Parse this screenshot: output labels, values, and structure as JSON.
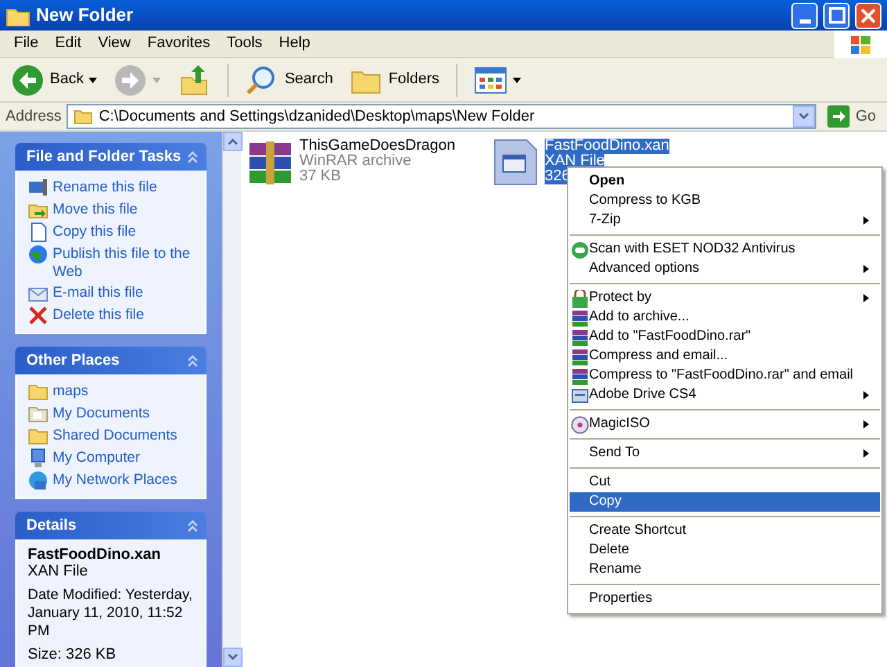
{
  "window": {
    "title": "New Folder"
  },
  "menu_bar": [
    "File",
    "Edit",
    "View",
    "Favorites",
    "Tools",
    "Help"
  ],
  "toolbar": [
    {
      "kind": "back",
      "label": "Back"
    },
    {
      "kind": "forward"
    },
    {
      "kind": "up"
    },
    {
      "kind": "search",
      "label": "Search"
    },
    {
      "kind": "folders",
      "label": "Folders"
    },
    {
      "kind": "views"
    }
  ],
  "address_bar": {
    "label": "Address",
    "value": "C:\\Documents and Settings\\dzanided\\Desktop\\maps\\New Folder",
    "go": "Go"
  },
  "side_panels": [
    {
      "kind": "links",
      "title": "File and Folder Tasks",
      "items": [
        "Rename this file",
        "Move this file",
        "Copy this file",
        "Publish this file to the Web",
        "E-mail this file",
        "Delete this file"
      ]
    },
    {
      "kind": "links",
      "title": "Other Places",
      "items": [
        "maps",
        "My Documents",
        "Shared Documents",
        "My Computer",
        "My Network Places"
      ]
    },
    {
      "kind": "details",
      "title": "Details",
      "name": "FastFoodDino.xan",
      "type": "XAN File",
      "modified": "Date Modified: Yesterday, January 11, 2010, 11:52 PM",
      "size": "Size: 326 KB"
    }
  ],
  "files": [
    {
      "kind": "rar",
      "name": "ThisGameDoesDragon",
      "type": "WinRAR archive",
      "size": "37 KB",
      "selected": false
    },
    {
      "kind": "document",
      "name": "FastFoodDino.xan",
      "type": "XAN File",
      "size": "326",
      "selected": true
    }
  ],
  "context_menu": [
    {
      "kind": "item",
      "label": "Open",
      "default": true,
      "submenu": false,
      "selected": false
    },
    {
      "kind": "item",
      "label": "Compress to KGB",
      "default": false,
      "submenu": false,
      "selected": false
    },
    {
      "kind": "item",
      "label": "7-Zip",
      "default": false,
      "submenu": true,
      "selected": false
    },
    {
      "kind": "separator"
    },
    {
      "kind": "item",
      "label": "Scan with ESET NOD32 Antivirus",
      "default": false,
      "submenu": false,
      "selected": false
    },
    {
      "kind": "item",
      "label": "Advanced options",
      "default": false,
      "submenu": true,
      "selected": false
    },
    {
      "kind": "separator"
    },
    {
      "kind": "item",
      "label": "Protect by",
      "default": false,
      "submenu": true,
      "selected": false
    },
    {
      "kind": "item",
      "label": "Add to archive...",
      "default": false,
      "submenu": false,
      "selected": false
    },
    {
      "kind": "item",
      "label": "Add to \"FastFoodDino.rar\"",
      "default": false,
      "submenu": false,
      "selected": false
    },
    {
      "kind": "item",
      "label": "Compress and email...",
      "default": false,
      "submenu": false,
      "selected": false
    },
    {
      "kind": "item",
      "label": "Compress to \"FastFoodDino.rar\" and email",
      "default": false,
      "submenu": false,
      "selected": false
    },
    {
      "kind": "item",
      "label": "Adobe Drive CS4",
      "default": false,
      "submenu": true,
      "selected": false
    },
    {
      "kind": "separator"
    },
    {
      "kind": "item",
      "label": "MagicISO",
      "default": false,
      "submenu": true,
      "selected": false
    },
    {
      "kind": "separator"
    },
    {
      "kind": "item",
      "label": "Send To",
      "default": false,
      "submenu": true,
      "selected": false
    },
    {
      "kind": "separator"
    },
    {
      "kind": "item",
      "label": "Cut",
      "default": false,
      "submenu": false,
      "selected": false
    },
    {
      "kind": "item",
      "label": "Copy",
      "default": false,
      "submenu": false,
      "selected": true
    },
    {
      "kind": "separator"
    },
    {
      "kind": "item",
      "label": "Create Shortcut",
      "default": false,
      "submenu": false,
      "selected": false
    },
    {
      "kind": "item",
      "label": "Delete",
      "default": false,
      "submenu": false,
      "selected": false
    },
    {
      "kind": "item",
      "label": "Rename",
      "default": false,
      "submenu": false,
      "selected": false
    },
    {
      "kind": "separator"
    },
    {
      "kind": "item",
      "label": "Properties",
      "default": false,
      "submenu": false,
      "selected": false
    }
  ]
}
